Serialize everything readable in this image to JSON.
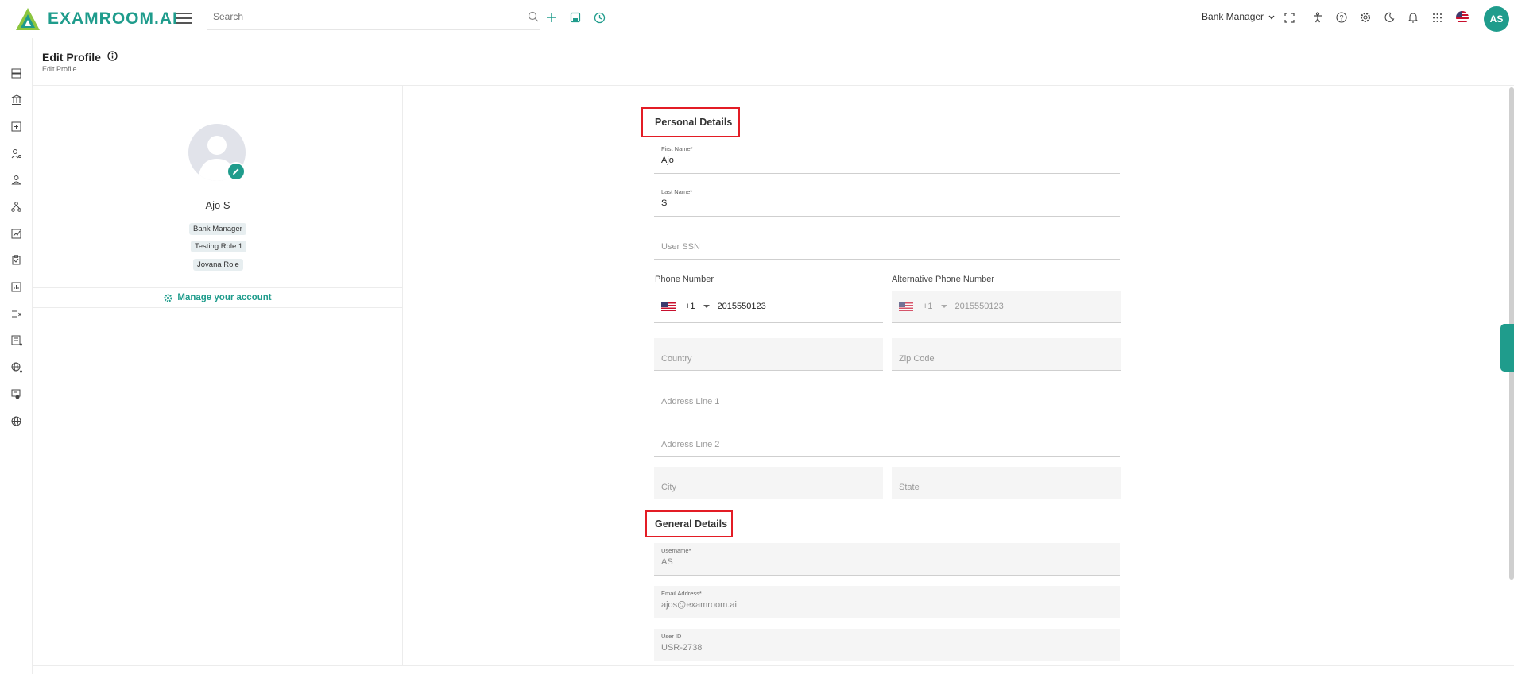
{
  "app": {
    "logo_text": "EXAMROOM.AI"
  },
  "topbar": {
    "search_placeholder": "Search",
    "role_label": "Bank Manager",
    "avatar_initials": "AS"
  },
  "page": {
    "title": "Edit Profile",
    "breadcrumb": "Edit Profile"
  },
  "profile": {
    "name": "Ajo S",
    "roles": [
      "Bank Manager",
      "Testing Role 1",
      "Jovana Role"
    ],
    "manage_label": "Manage your account"
  },
  "personal": {
    "section_title": "Personal Details",
    "first_name_label": "First Name*",
    "first_name_value": "Ajo",
    "last_name_label": "Last Name*",
    "last_name_value": "S",
    "ssn_placeholder": "User SSN",
    "phone_label": "Phone Number",
    "phone_code": "+1",
    "phone_value": "2015550123",
    "alt_phone_label": "Alternative Phone Number",
    "alt_phone_code": "+1",
    "alt_phone_value": "2015550123",
    "country_placeholder": "Country",
    "zip_placeholder": "Zip Code",
    "address1_placeholder": "Address Line 1",
    "address2_placeholder": "Address Line 2",
    "city_placeholder": "City",
    "state_placeholder": "State"
  },
  "general": {
    "section_title": "General Details",
    "username_label": "Username*",
    "username_value": "AS",
    "email_label": "Email Address*",
    "email_value": "ajos@examroom.ai",
    "userid_label": "User ID",
    "userid_value": "USR-2738"
  },
  "colors": {
    "accent": "#1f9c8c",
    "highlight": "#e31c25"
  }
}
